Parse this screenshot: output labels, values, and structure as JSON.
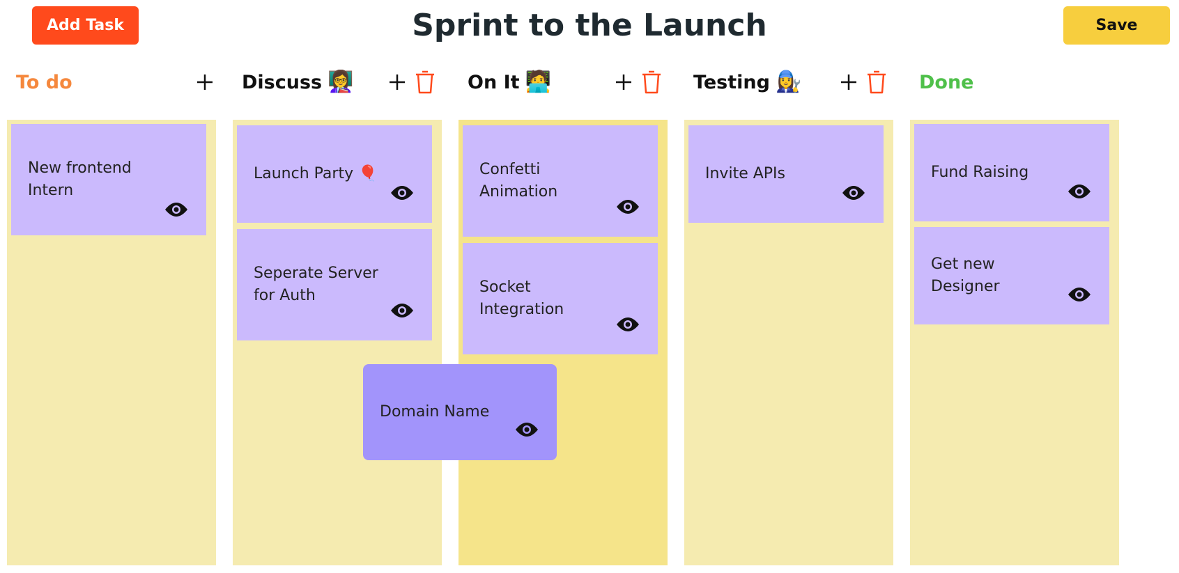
{
  "header": {
    "title": "Sprint to the Launch",
    "add_task_label": "Add Task",
    "save_label": "Save"
  },
  "colors": {
    "add_button": "#ff4a1c",
    "save_button": "#f7ce3e",
    "column_bg": "#f5ebb0",
    "column_bg_highlight": "#f5e48a",
    "card_bg": "#cbbafd",
    "dragging_card_bg": "#a294fb",
    "trash_icon": "#ff4a1c"
  },
  "columns": [
    {
      "title": "To do",
      "title_color": "#f5883d",
      "emoji": "",
      "icons": [
        "plus-icon"
      ],
      "cards": [
        {
          "text": "New frontend Intern"
        }
      ]
    },
    {
      "title": "Discuss",
      "title_color": "#111111",
      "emoji": "👩‍🏫",
      "icons": [
        "plus-icon",
        "trash-icon"
      ],
      "cards": [
        {
          "text": "Launch Party 🎈"
        },
        {
          "text": "Seperate Server for Auth"
        }
      ]
    },
    {
      "title": "On It",
      "title_color": "#111111",
      "emoji": "🧑‍💻",
      "icons": [
        "plus-icon",
        "trash-icon"
      ],
      "cards": [
        {
          "text": "Confetti Animation"
        },
        {
          "text": "Socket Integration"
        }
      ]
    },
    {
      "title": "Testing",
      "title_color": "#111111",
      "emoji": "👩‍🔧",
      "icons": [
        "plus-icon",
        "trash-icon"
      ],
      "cards": [
        {
          "text": "Invite APIs"
        }
      ]
    },
    {
      "title": "Done",
      "title_color": "#4fc04a",
      "emoji": "",
      "icons": [],
      "cards": [
        {
          "text": "Fund Raising"
        },
        {
          "text": "Get new Designer"
        }
      ]
    }
  ],
  "dragging_card": {
    "text": "Domain Name"
  }
}
